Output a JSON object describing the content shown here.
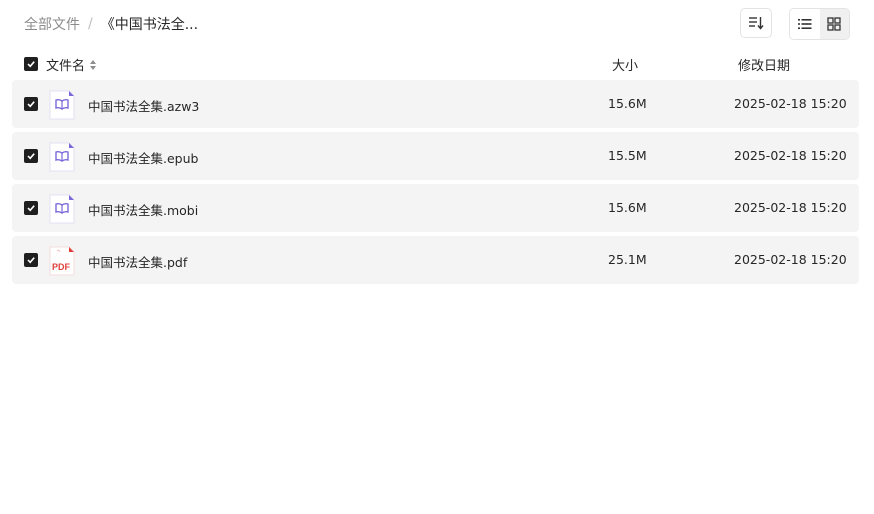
{
  "breadcrumb": {
    "root": "全部文件",
    "separator": "/",
    "current": "《中国书法全..."
  },
  "toolbar": {
    "sort_icon": "sort-icon",
    "list_view_icon": "list-view-icon",
    "grid_view_icon": "grid-view-icon"
  },
  "table": {
    "columns": {
      "name": "文件名",
      "size": "大小",
      "date": "修改日期"
    },
    "rows": [
      {
        "name": "中国书法全集.azw3",
        "size": "15.6M",
        "date": "2025-02-18 15:20",
        "icon": "ebook-icon",
        "checked": true
      },
      {
        "name": "中国书法全集.epub",
        "size": "15.5M",
        "date": "2025-02-18 15:20",
        "icon": "ebook-icon",
        "checked": true
      },
      {
        "name": "中国书法全集.mobi",
        "size": "15.6M",
        "date": "2025-02-18 15:20",
        "icon": "ebook-icon",
        "checked": true
      },
      {
        "name": "中国书法全集.pdf",
        "size": "25.1M",
        "date": "2025-02-18 15:20",
        "icon": "pdf-icon",
        "pdf_label": "PDF",
        "checked": true
      }
    ]
  },
  "colors": {
    "ebook_accent": "#7b68d8",
    "pdf_accent": "#e0403a",
    "row_bg": "#f4f4f5",
    "checkbox": "#1f1f1f"
  }
}
